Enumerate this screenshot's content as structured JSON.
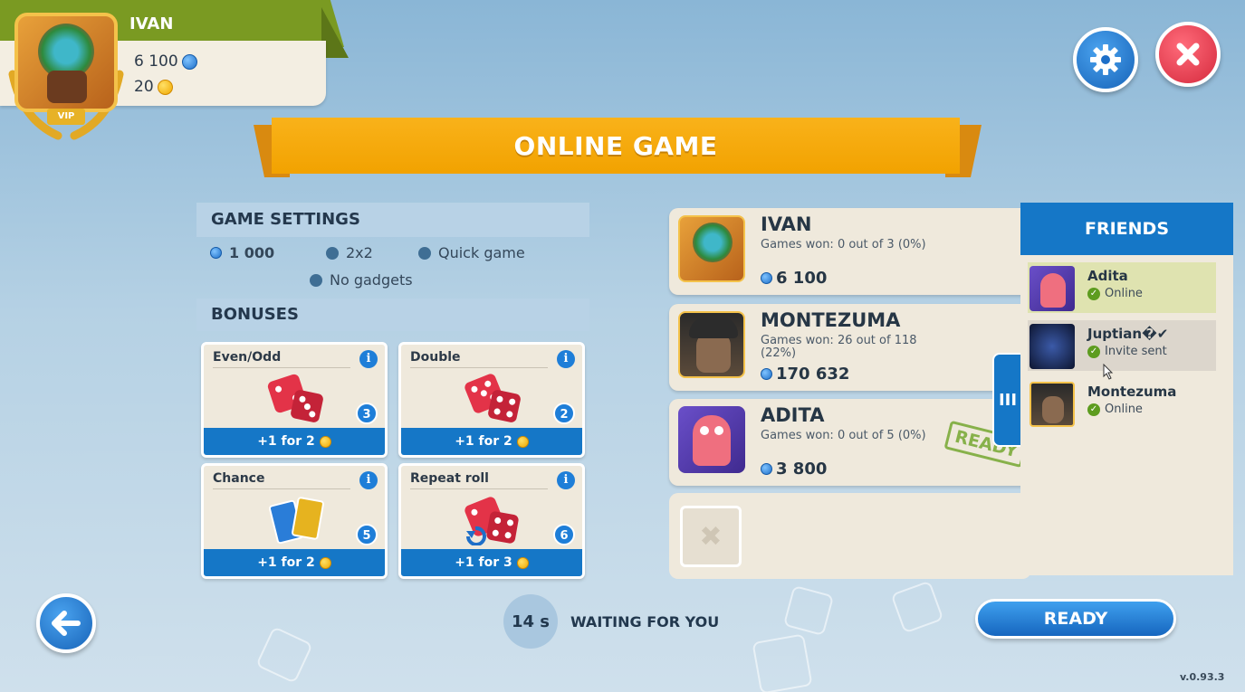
{
  "profile": {
    "name": "IVAN",
    "gems": "6 100",
    "coins": "20",
    "badge": "VIP"
  },
  "title": "ONLINE GAME",
  "game_settings": {
    "header": "GAME SETTINGS",
    "stake": "1 000",
    "mode": "2x2",
    "speed": "Quick game",
    "gadgets": "No gadgets"
  },
  "bonuses": {
    "header": "BONUSES",
    "items": [
      {
        "title": "Even/Odd",
        "count": "3",
        "cost": "+1 for 2"
      },
      {
        "title": "Double",
        "count": "2",
        "cost": "+1 for 2"
      },
      {
        "title": "Chance",
        "count": "5",
        "cost": "+1 for 2"
      },
      {
        "title": "Repeat roll",
        "count": "6",
        "cost": "+1 for 3"
      }
    ]
  },
  "players": [
    {
      "name": "IVAN",
      "stat": "Games won: 0 out of 3 (0%)",
      "gems": "6 100"
    },
    {
      "name": "MONTEZUMA",
      "stat": "Games won: 26 out of 118 (22%)",
      "gems": "170 632"
    },
    {
      "name": "ADITA",
      "stat": "Games won: 0 out of 5 (0%)",
      "gems": "3 800",
      "stamp": "READY"
    }
  ],
  "empty_slot": "✖",
  "friends": {
    "header": "FRIENDS",
    "items": [
      {
        "name": "Adita",
        "status": "Online"
      },
      {
        "name": "Juptian�✔",
        "status": "Invite sent"
      },
      {
        "name": "Montezuma",
        "status": "Online"
      }
    ]
  },
  "handle": "III",
  "timer": "14 s",
  "waiting": "WAITING FOR YOU",
  "ready_button": "READY",
  "version": "v.0.93.3",
  "colors": {
    "accent_blue": "#1577c7",
    "ribbon_orange": "#f2a200",
    "profile_green": "#7a9a22",
    "close_red": "#d52a3d",
    "ready_green": "#7cab3b"
  },
  "icons": [
    "gear-icon",
    "close-icon",
    "back-arrow-icon",
    "info-icon",
    "gem-icon",
    "coin-icon",
    "check-icon"
  ]
}
